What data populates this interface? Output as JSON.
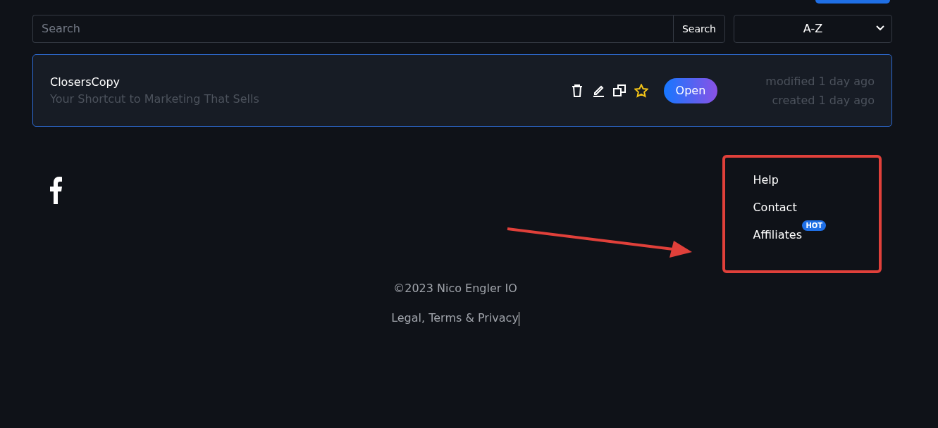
{
  "search": {
    "placeholder": "Search",
    "button": "Search"
  },
  "sort": {
    "value": "A-Z"
  },
  "projects": [
    {
      "name": "ClosersCopy",
      "tagline": "Your Shortcut to Marketing That Sells",
      "starred": false,
      "open": "Open",
      "modified": "modified 1 day ago",
      "created": "created 1 day ago"
    }
  ],
  "footer": {
    "links": [
      {
        "label": "Help"
      },
      {
        "label": "Contact"
      },
      {
        "label": "Affiliates",
        "badge": "HOT"
      }
    ],
    "copyright": "©2023 Nico Engler IO",
    "legal": "Legal, Terms & Privacy"
  }
}
